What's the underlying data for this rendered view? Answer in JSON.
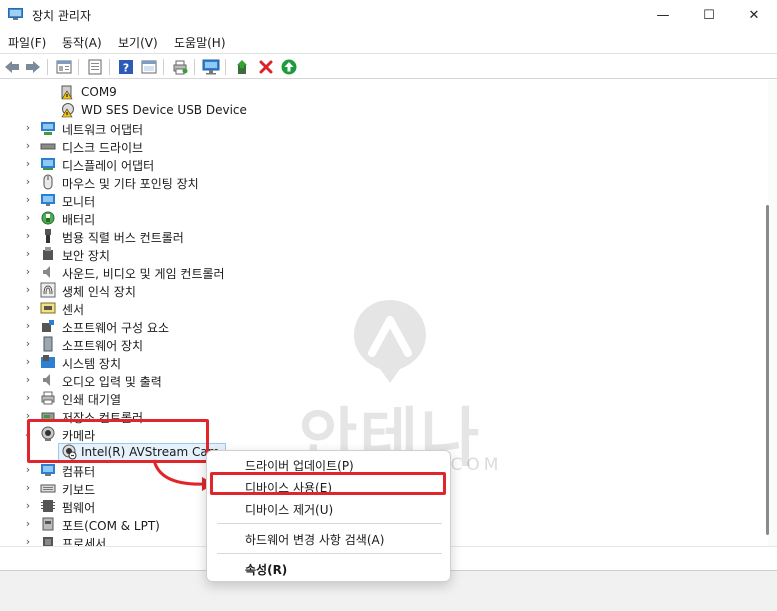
{
  "window": {
    "title": "장치 관리자",
    "minimize": "—",
    "maximize": "☐",
    "close": "✕"
  },
  "menu": [
    "파일(F)",
    "동작(A)",
    "보기(V)",
    "도움말(H)"
  ],
  "toolbar": {
    "icons": [
      "back-arrow-icon",
      "forward-arrow-icon",
      "properties-icon",
      "details-icon",
      "help-icon",
      "view-icon",
      "print-icon",
      "monitor-scan-icon",
      "update-driver-icon",
      "uninstall-x-icon",
      "enable-device-icon"
    ]
  },
  "tree": {
    "children_above": [
      {
        "label": "COM9",
        "icon": "port-warning-icon"
      },
      {
        "label": "WD SES Device USB Device",
        "icon": "device-warning-icon"
      }
    ],
    "categories": [
      {
        "label": "네트워크 어댑터",
        "icon": "network-adapter-icon"
      },
      {
        "label": "디스크 드라이브",
        "icon": "disk-drive-icon"
      },
      {
        "label": "디스플레이 어댑터",
        "icon": "display-adapter-icon"
      },
      {
        "label": "마우스 및 기타 포인팅 장치",
        "icon": "mouse-icon"
      },
      {
        "label": "모니터",
        "icon": "monitor-icon"
      },
      {
        "label": "배터리",
        "icon": "battery-icon"
      },
      {
        "label": "범용 직렬 버스 컨트롤러",
        "icon": "usb-icon"
      },
      {
        "label": "보안 장치",
        "icon": "security-device-icon"
      },
      {
        "label": "사운드, 비디오 및 게임 컨트롤러",
        "icon": "sound-icon"
      },
      {
        "label": "생체 인식 장치",
        "icon": "biometric-icon"
      },
      {
        "label": "센서",
        "icon": "sensor-icon"
      },
      {
        "label": "소프트웨어 구성 요소",
        "icon": "software-component-icon"
      },
      {
        "label": "소프트웨어 장치",
        "icon": "software-device-icon"
      },
      {
        "label": "시스템 장치",
        "icon": "system-device-icon"
      },
      {
        "label": "오디오 입력 및 출력",
        "icon": "audio-io-icon"
      },
      {
        "label": "인쇄 대기열",
        "icon": "print-queue-icon"
      },
      {
        "label": "저장소 컨트롤러",
        "icon": "storage-controller-icon"
      }
    ],
    "camera": {
      "label": "카메라",
      "icon": "camera-icon",
      "child": "Intel(R) AVStream Cam"
    },
    "categories_below": [
      {
        "label": "컴퓨터",
        "icon": "computer-icon"
      },
      {
        "label": "키보드",
        "icon": "keyboard-icon"
      },
      {
        "label": "펌웨어",
        "icon": "firmware-icon"
      },
      {
        "label": "포트(COM & LPT)",
        "icon": "port-icon"
      },
      {
        "label": "프로세서",
        "icon": "processor-icon"
      }
    ]
  },
  "context_menu": {
    "items": [
      "드라이버 업데이트(P)",
      "디바이스 사용(E)",
      "디바이스 제거(U)",
      "하드웨어 변경 사항 검색(A)",
      "속성(R)"
    ]
  },
  "watermark": {
    "text": "안테나곰",
    "sub": "ANTENNAGOM.COM"
  },
  "colors": {
    "highlight_red": "#e0262b",
    "selection_bg": "#e5f1fb"
  }
}
